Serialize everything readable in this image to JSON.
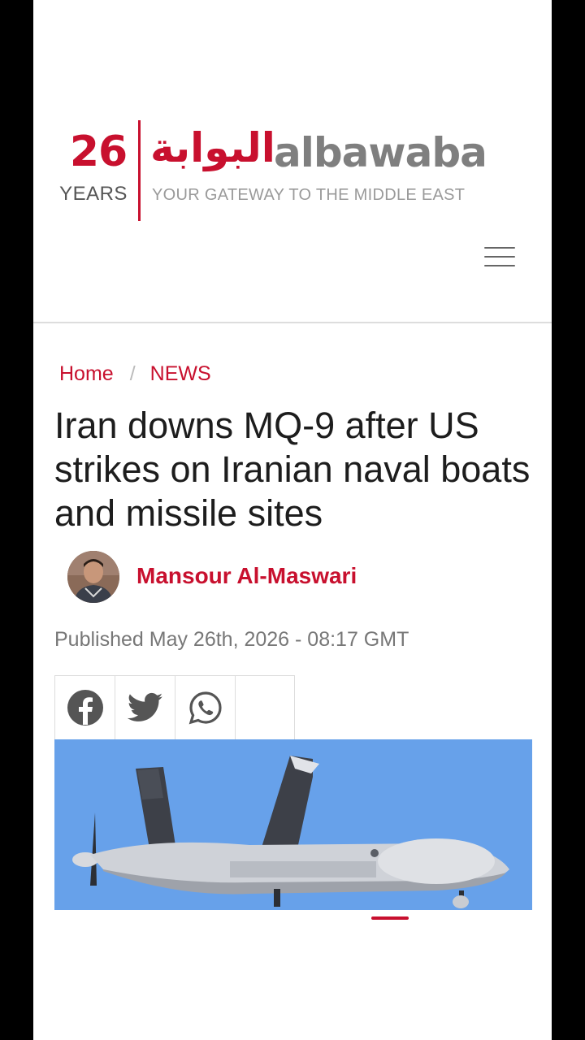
{
  "logo": {
    "years_number": "26",
    "years_label": "YEARS",
    "arabic_name": "البوابة",
    "latin_name": "albawaba",
    "tagline": "YOUR GATEWAY TO THE MIDDLE EAST"
  },
  "breadcrumb": {
    "home": "Home",
    "separator": "/",
    "section": "NEWS"
  },
  "article": {
    "title": "Iran downs MQ-9 after US strikes on Iranian naval boats and missile sites",
    "author": "Mansour Al-Maswari",
    "published": "Published May 26th, 2026 - 08:17 GMT"
  },
  "share": {
    "buttons": [
      "facebook-icon",
      "twitter-icon",
      "whatsapp-icon",
      "empty"
    ]
  },
  "colors": {
    "brand_red": "#c8102e",
    "logo_gray": "#7f7f7f",
    "sky_blue": "#6aa3ec"
  }
}
